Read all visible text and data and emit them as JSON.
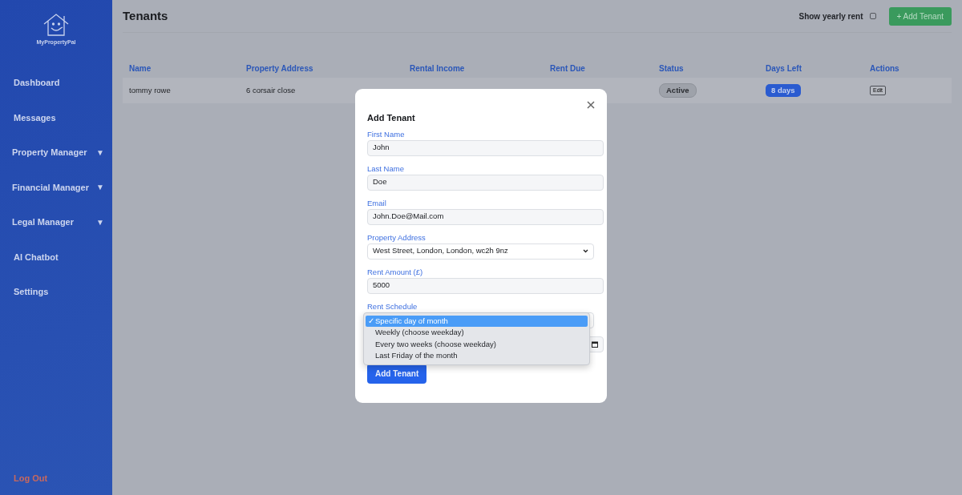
{
  "sidebar": {
    "logo_text": "MyPropertyPal",
    "items": [
      {
        "label": "Dashboard"
      },
      {
        "label": "Messages"
      },
      {
        "label": "Property Manager",
        "caret": "▼"
      },
      {
        "label": "Financial Manager",
        "caret": "▼"
      },
      {
        "label": "Legal Manager",
        "caret": "▼"
      },
      {
        "label": "AI Chatbot"
      },
      {
        "label": "Settings"
      }
    ],
    "logout": "Log Out"
  },
  "header": {
    "title": "Tenants",
    "yearly_toggle": {
      "label": "Show yearly rent",
      "checked": false
    },
    "add_button": "+ Add Tenant"
  },
  "table": {
    "columns": [
      "Name",
      "Property Address",
      "Rental Income",
      "Rent Due",
      "Status",
      "Days Left",
      "Actions"
    ],
    "rows": [
      {
        "name": "tommy rowe",
        "address": "6 corsair close",
        "status": "Active",
        "days_left": "8 days",
        "action": "Edit"
      }
    ]
  },
  "modal": {
    "title": "Add Tenant",
    "fields": [
      {
        "kind": "text",
        "label": "First Name",
        "value": "John"
      },
      {
        "kind": "text",
        "label": "Last Name",
        "value": "Doe"
      },
      {
        "kind": "text",
        "label": "Email",
        "value": "John.Doe@Mail.com"
      },
      {
        "kind": "select",
        "label": "Property Address",
        "value": "West Street, London, London, wc2h 9nz"
      },
      {
        "kind": "text",
        "label": "Rent Amount (£)",
        "value": "5000"
      },
      {
        "kind": "open-select",
        "label": "Rent Schedule",
        "options": [
          {
            "label": "Specific day of month",
            "selected": true,
            "tick": "✓"
          },
          {
            "label": "Weekly (choose weekday)",
            "selected": false
          },
          {
            "label": "Every two weeks (choose weekday)",
            "selected": false
          },
          {
            "label": "Last Friday of the month",
            "selected": false
          }
        ]
      },
      {
        "kind": "date"
      }
    ],
    "submit": "Add Tenant"
  }
}
